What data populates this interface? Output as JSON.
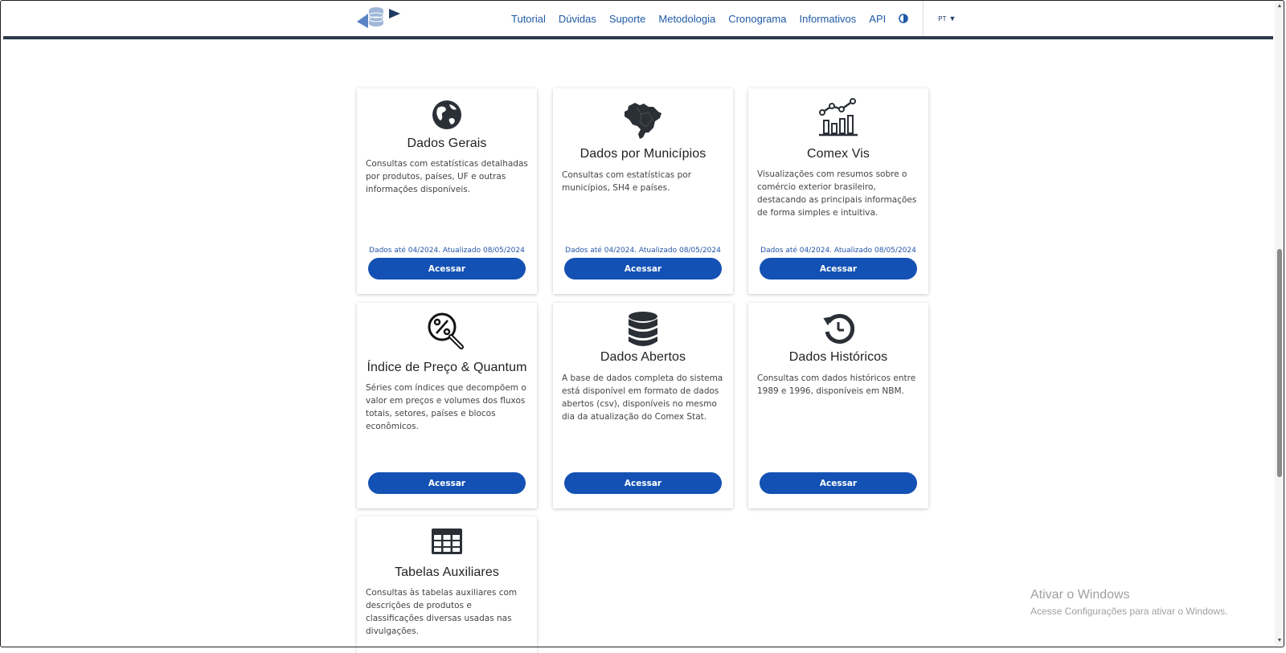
{
  "nav": {
    "links": [
      "Tutorial",
      "Dúvidas",
      "Suporte",
      "Metodologia",
      "Cronograma",
      "Informativos",
      "API"
    ],
    "lang": "PT",
    "contrast_icon": "contrast-icon",
    "logo_icon": "comexstat-logo"
  },
  "cards": [
    {
      "title": "Dados Gerais",
      "icon": "globe-icon",
      "desc": "Consultas com estatísticas detalhadas por produtos, países, UF e outras informações disponíveis.",
      "updated": "Dados até 04/2024. Atualizado 08/05/2024",
      "button": "Acessar"
    },
    {
      "title": "Dados por Municípios",
      "icon": "brazil-map-icon",
      "desc": "Consultas com estatísticas por municípios, SH4 e países.",
      "updated": "Dados até 04/2024. Atualizado 08/05/2024",
      "button": "Acessar"
    },
    {
      "title": "Comex Vis",
      "icon": "chart-icon",
      "desc": "Visualizações com resumos sobre o comércio exterior brasileiro, destacando as principais informações de forma simples e intuitiva.",
      "updated": "Dados até 04/2024. Atualizado 08/05/2024",
      "button": "Acessar"
    },
    {
      "title": "Índice de Preço & Quantum",
      "icon": "percent-search-icon",
      "desc": "Séries com índices que decompõem o valor em preços e volumes dos fluxos totais, setores, países e blocos econômicos.",
      "button": "Acessar"
    },
    {
      "title": "Dados Abertos",
      "icon": "database-icon",
      "desc": "A base de dados completa do sistema está disponível em formato de dados abertos (csv), disponíveis no mesmo dia da atualização do Comex Stat.",
      "button": "Acessar"
    },
    {
      "title": "Dados Históricos",
      "icon": "history-icon",
      "desc": "Consultas com dados históricos entre 1989 e 1996, disponíveis em NBM.",
      "button": "Acessar"
    },
    {
      "title": "Tabelas Auxiliares",
      "icon": "table-icon",
      "desc": "Consultas às tabelas auxiliares com descrições de produtos e classificações diversas usadas nas divulgações."
    }
  ],
  "watermark": {
    "title": "Ativar o Windows",
    "subtitle": "Acesse Configurações para ativar o Windows."
  }
}
